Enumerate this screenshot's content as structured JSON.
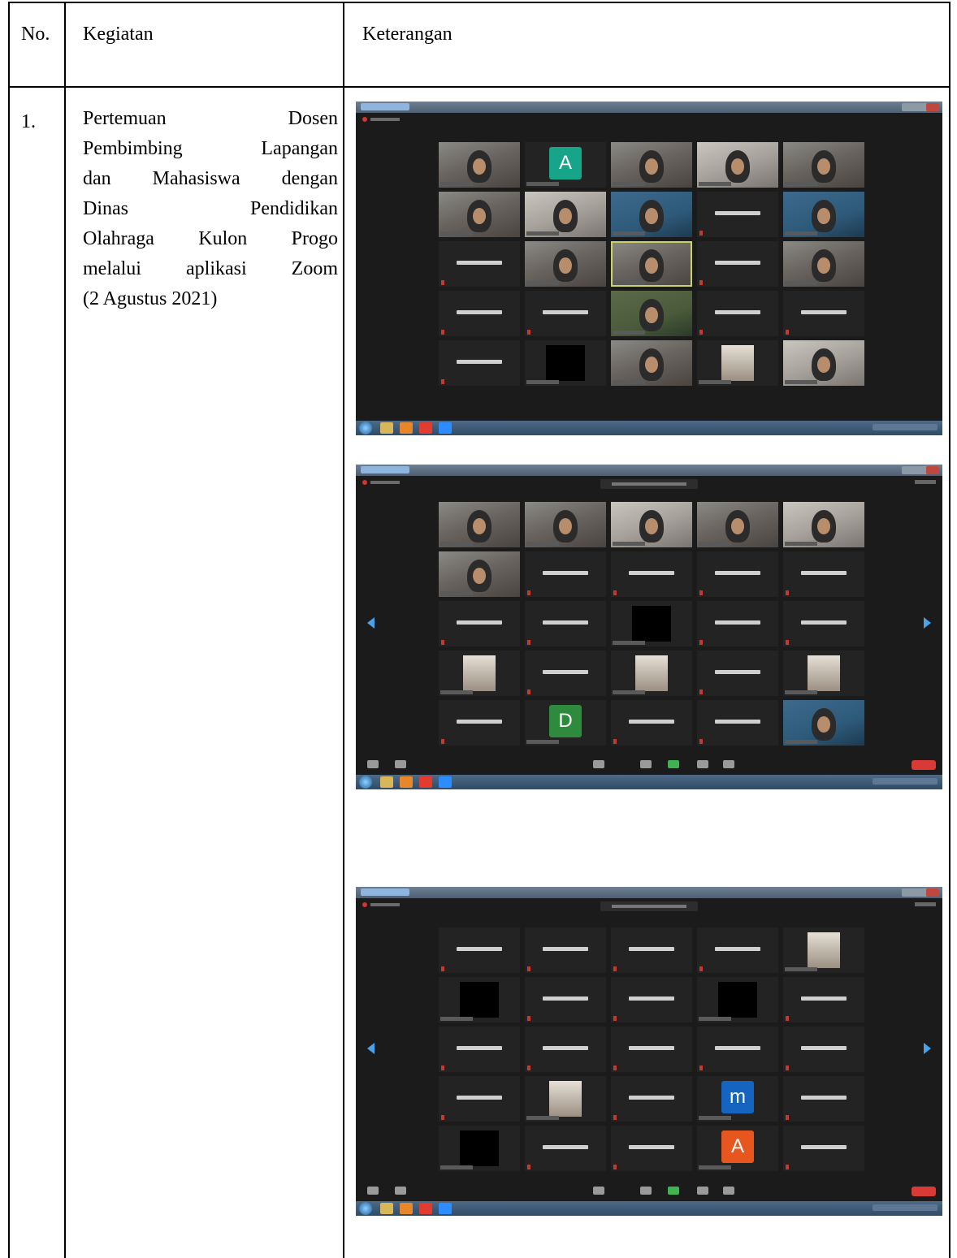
{
  "table": {
    "headers": [
      "No.",
      "Kegiatan",
      "Keterangan"
    ],
    "rows": [
      {
        "no": "1.",
        "kegiatan_lines": [
          [
            "Pertemuan",
            "Dosen"
          ],
          [
            "Pembimbing",
            "Lapangan"
          ],
          [
            "dan",
            "Mahasiswa",
            "dengan"
          ],
          [
            "Dinas",
            "Pendidikan"
          ],
          [
            "Olahraga",
            "Kulon",
            "Progo"
          ],
          [
            "melalui",
            "aplikasi",
            "Zoom"
          ],
          [
            "(2 Agustus 2021)"
          ]
        ]
      }
    ]
  },
  "screenshots": [
    {
      "name": "zoom-screenshot-1",
      "tiles": [
        "video",
        "avatar:A:#17a589",
        "video",
        "video-b",
        "video",
        "video",
        "video-b",
        "video-c",
        "name",
        "video-c",
        "name",
        "video",
        "video-speaker",
        "name",
        "video",
        "name",
        "name",
        "video-d",
        "name",
        "name",
        "name",
        "blackbox",
        "video",
        "photo",
        "video-b"
      ]
    },
    {
      "name": "zoom-screenshot-2",
      "tiles": [
        "video",
        "video",
        "video-b",
        "video",
        "video-b",
        "video",
        "name",
        "name",
        "name",
        "name",
        "name",
        "name",
        "blackbox",
        "name",
        "name",
        "photo",
        "name",
        "photo",
        "name",
        "photo",
        "name",
        "avatar:D:#2e8b3e",
        "name",
        "name",
        "video-c"
      ]
    },
    {
      "name": "zoom-screenshot-3",
      "tiles": [
        "name",
        "name",
        "name",
        "name",
        "photo",
        "blackbox",
        "name",
        "name",
        "blackbox",
        "name",
        "name",
        "name",
        "name",
        "name",
        "name",
        "name",
        "photo",
        "name",
        "avatar:m:#1565c0",
        "name",
        "blackbox",
        "name",
        "name",
        "avatar:A:#e8561f",
        "name"
      ]
    }
  ]
}
